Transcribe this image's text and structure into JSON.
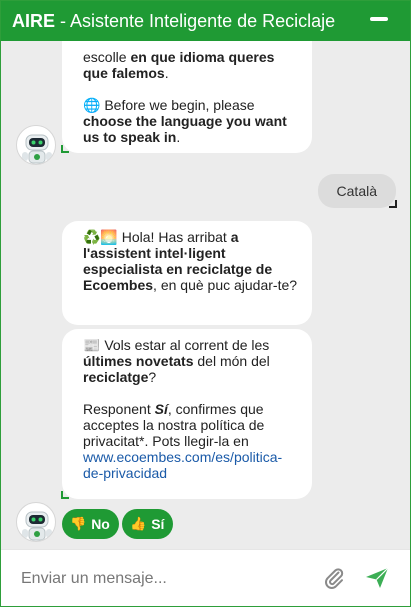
{
  "header": {
    "brand": "AIRE",
    "title": " - Asistente Inteligente de Reciclaje"
  },
  "messages": {
    "intro_gl": {
      "line1": "escolle ",
      "bold1": "en que idioma queres que falemos",
      "end1": "."
    },
    "intro_en": {
      "emoji": "🌐",
      "text": " Before we begin, please ",
      "bold": "choose the language you want us to speak in",
      "end": "."
    },
    "user_reply": "Català",
    "welcome": {
      "emoji": "♻️🌅",
      "text1": " Hola! Has arribat ",
      "bold": "a l'assistent intel·ligent especialista en reciclatge de Ecoembes",
      "text2": ", en què puc ajudar-te?"
    },
    "newsletter": {
      "emoji": "📰",
      "text1": " Vols estar al corrent de les ",
      "bold1": "últimes novetats",
      "text2": " del món del ",
      "bold2": "reciclatge",
      "text3": "?",
      "p2_1": "Responent ",
      "p2_bold": "Sí",
      "p2_2": ", confirmes que acceptes la nostra política de privacitat*. Pots llegir-la en ",
      "link": "www.ecoembes.com/es/politica-de-privacidad"
    }
  },
  "quick_replies": [
    {
      "label": "No",
      "icon": "thumbs-down"
    },
    {
      "label": "Sí",
      "icon": "thumbs-up"
    }
  ],
  "composer": {
    "placeholder": "Enviar un mensaje..."
  },
  "colors": {
    "brand_green": "#1f9a34",
    "link_blue": "#1a5aa8"
  }
}
